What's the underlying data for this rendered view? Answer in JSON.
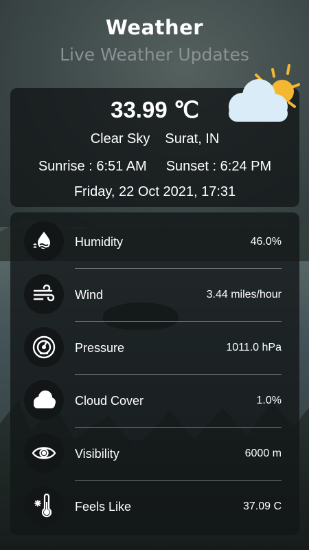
{
  "header": {
    "title": "Weather",
    "subtitle": "Live Weather Updates"
  },
  "summary": {
    "temperature": "33.99 ℃",
    "condition": "Clear Sky",
    "location": "Surat, IN",
    "sunrise": "Sunrise : 6:51 AM",
    "sunset": "Sunset : 6:24 PM",
    "datetime": "Friday, 22 Oct 2021, 17:31",
    "icon": "partly-cloudy-icon"
  },
  "details": [
    {
      "label": "Humidity",
      "value": "46.0%",
      "icon": "humidity-icon"
    },
    {
      "label": "Wind",
      "value": "3.44 miles/hour",
      "icon": "wind-icon"
    },
    {
      "label": "Pressure",
      "value": "1011.0 hPa",
      "icon": "pressure-gauge-icon"
    },
    {
      "label": "Cloud Cover",
      "value": "1.0%",
      "icon": "cloud-icon"
    },
    {
      "label": "Visibility",
      "value": "6000 m",
      "icon": "eye-icon"
    },
    {
      "label": "Feels Like",
      "value": "37.09 C",
      "icon": "thermometer-icon"
    }
  ],
  "colors": {
    "text": "#ffffff",
    "subtitle": "#8a9293",
    "card_bg": "#121617",
    "sun": "#f5b731",
    "cloud": "#d9ecf8"
  }
}
